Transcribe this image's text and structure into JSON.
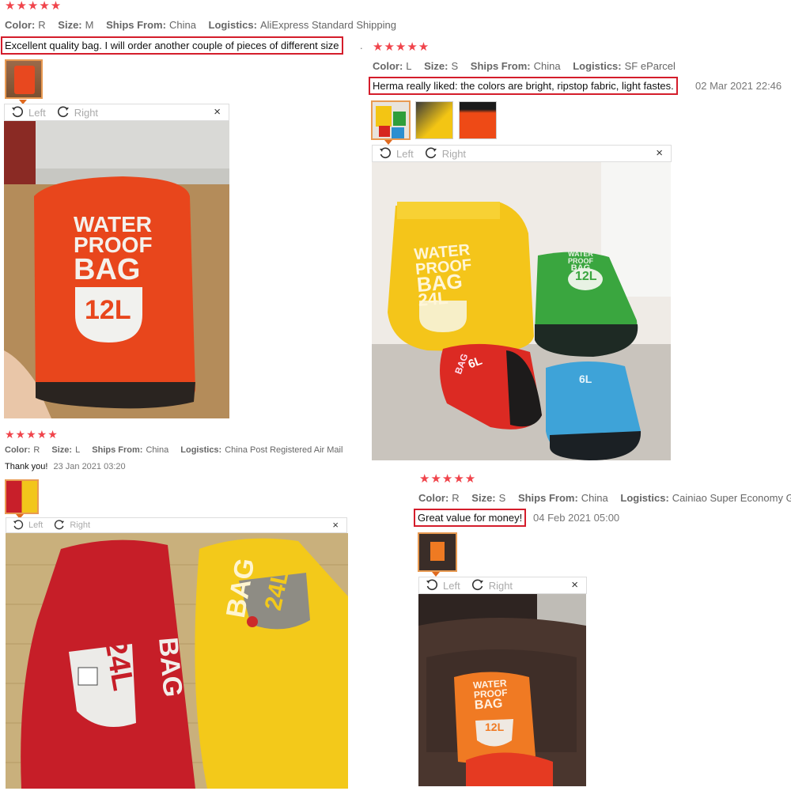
{
  "viewer": {
    "left": "Left",
    "right": "Right",
    "close": "×"
  },
  "reviews": [
    {
      "stars": "★★★★★",
      "meta": [
        {
          "label": "Color:",
          "value": "R"
        },
        {
          "label": "Size:",
          "value": "M"
        },
        {
          "label": "Ships From:",
          "value": "China"
        },
        {
          "label": "Logistics:",
          "value": "AliExpress Standard Shipping"
        }
      ],
      "text": "Excellent quality bag. I will order another couple of pieces of different size",
      "trail": "."
    },
    {
      "stars": "★★★★★",
      "meta": [
        {
          "label": "Color:",
          "value": "L"
        },
        {
          "label": "Size:",
          "value": "S"
        },
        {
          "label": "Ships From:",
          "value": "China"
        },
        {
          "label": "Logistics:",
          "value": "SF eParcel"
        }
      ],
      "text": "Herma really liked: the colors are bright, ripstop fabric, light fastes.",
      "date": "02 Mar 2021 22:46"
    },
    {
      "stars": "★★★★★",
      "meta": [
        {
          "label": "Color:",
          "value": "R"
        },
        {
          "label": "Size:",
          "value": "L"
        },
        {
          "label": "Ships From:",
          "value": "China"
        },
        {
          "label": "Logistics:",
          "value": "China Post Registered Air Mail"
        }
      ],
      "text": "Thank you!",
      "date": "23 Jan 2021 03:20"
    },
    {
      "stars": "★★★★★",
      "meta": [
        {
          "label": "Color:",
          "value": "R"
        },
        {
          "label": "Size:",
          "value": "S"
        },
        {
          "label": "Ships From:",
          "value": "China"
        },
        {
          "label": "Logistics:",
          "value": "Cainiao Super Economy Globa"
        }
      ],
      "text": "Great value for money!",
      "date": "04 Feb 2021 05:00"
    }
  ],
  "bags": {
    "b1": {
      "l1": "WATER",
      "l2": "PROOF",
      "l3": "BAG",
      "size": "12L"
    },
    "b2_yellow": {
      "l1": "WATER",
      "l2": "PROOF",
      "l3": "BAG",
      "size": "24L"
    },
    "b2_green": {
      "l1": "WATER",
      "l2": "PROOF",
      "l3": "BAG",
      "size": "12L"
    },
    "b2_red": {
      "l1": "BAG",
      "size": "6L"
    },
    "b2_blue": {
      "size": "6L"
    },
    "b3_red": {
      "l1": "BAG",
      "size": "24L"
    },
    "b3_yellow": {
      "l1": "BAG",
      "size": "24L"
    },
    "b4": {
      "l1": "WATER",
      "l2": "PROOF",
      "l3": "BAG",
      "size": "12L"
    }
  }
}
